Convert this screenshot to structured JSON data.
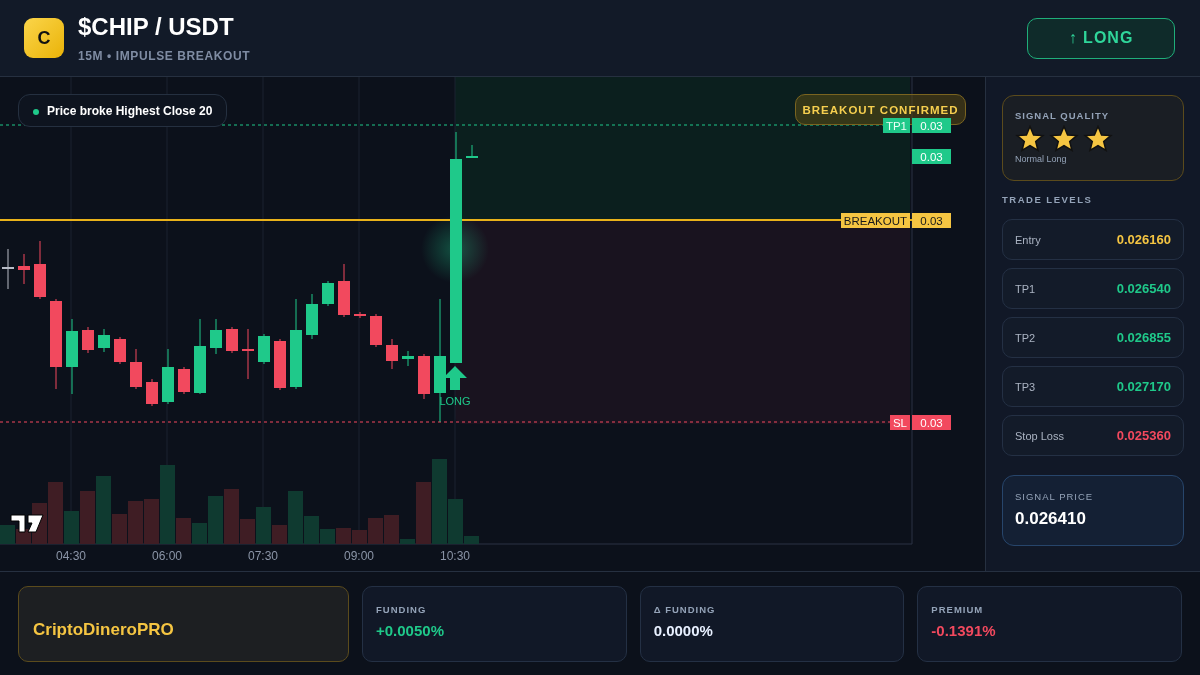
{
  "header": {
    "logo_letter": "C",
    "title": "$CHIP / USDT",
    "subtitle": "15M • IMPULSE BREAKOUT",
    "direction_button": {
      "label": "↑ LONG"
    }
  },
  "chart": {
    "info_pill": {
      "text": "Price broke Highest Close 20"
    },
    "confirmed_badge": {
      "text": "BREAKOUT CONFIRMED"
    },
    "price_tags": [
      {
        "kind": "tp",
        "label": "TP1",
        "value": "0.03"
      },
      {
        "kind": "current",
        "value": "0.03"
      },
      {
        "kind": "breakout",
        "label": "BREAKOUT",
        "value": "0.03"
      },
      {
        "kind": "sl",
        "label": "SL",
        "value": "0.03"
      }
    ],
    "signal_marker": {
      "label": "LONG"
    },
    "time_labels": [
      "04:30",
      "06:00",
      "07:30",
      "09:00",
      "10:30"
    ]
  },
  "sidebar": {
    "signal_quality": {
      "title": "SIGNAL QUALITY",
      "stars": 3,
      "caption": "Normal Long"
    },
    "trade_levels": {
      "title": "TRADE LEVELS",
      "rows": [
        {
          "label": "Entry",
          "value": "0.026160",
          "kind": "entry"
        },
        {
          "label": "TP1",
          "value": "0.026540",
          "kind": "tp"
        },
        {
          "label": "TP2",
          "value": "0.026855",
          "kind": "tp"
        },
        {
          "label": "TP3",
          "value": "0.027170",
          "kind": "tp"
        },
        {
          "label": "Stop Loss",
          "value": "0.025360",
          "kind": "sl"
        }
      ]
    },
    "signal_price": {
      "title": "SIGNAL PRICE",
      "value": "0.026410"
    }
  },
  "footer": {
    "brand": "CriptoDineroPRO",
    "metrics": [
      {
        "label": "FUNDING",
        "value": "+0.0050%",
        "kind": "positive"
      },
      {
        "label": "Δ FUNDING",
        "value": "0.0000%",
        "kind": "neutral"
      },
      {
        "label": "PREMIUM",
        "value": "-0.1391%",
        "kind": "negative"
      }
    ]
  }
}
